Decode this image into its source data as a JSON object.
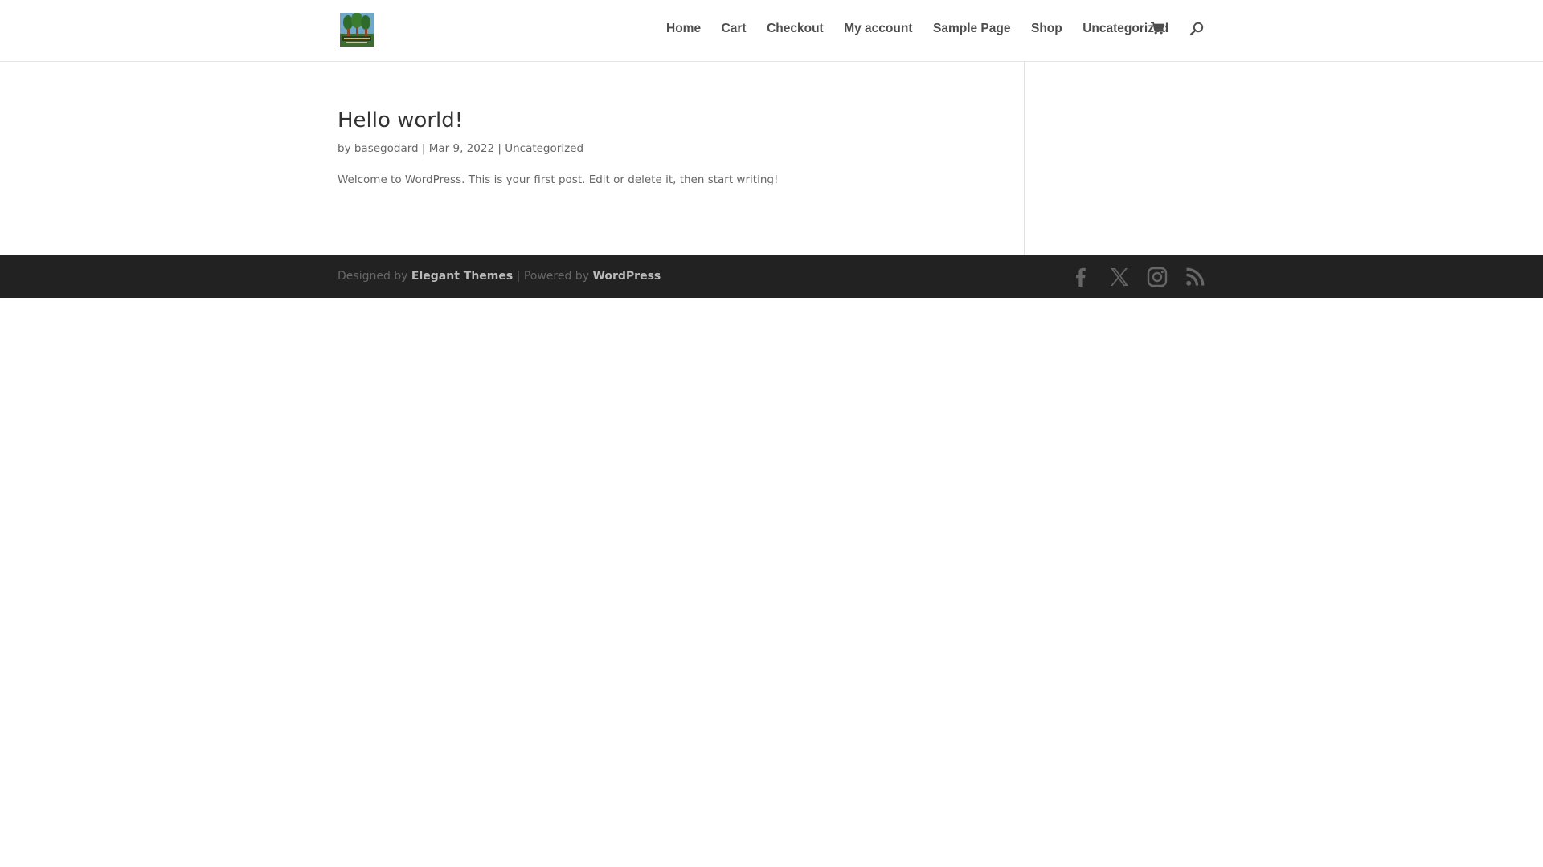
{
  "colors": {
    "header_bg": "#ffffff",
    "nav_text": "#4d4d4d",
    "title_text": "#333333",
    "body_text": "#666666",
    "footer_bg": "#222222",
    "footer_link": "#bbbbbb",
    "social_icon": "#666666"
  },
  "header": {
    "logo_icon": "elevated-trees-logo",
    "nav": [
      {
        "label": "Home"
      },
      {
        "label": "Cart"
      },
      {
        "label": "Checkout"
      },
      {
        "label": "My account"
      },
      {
        "label": "Sample Page"
      },
      {
        "label": "Shop"
      },
      {
        "label": "Uncategorized"
      }
    ],
    "cart_icon": "shopping-cart-icon",
    "search_icon": "search-icon"
  },
  "post": {
    "title": "Hello world!",
    "meta": {
      "by": "by",
      "author": "basegodard",
      "sep1": "|",
      "date": "Mar 9, 2022",
      "sep2": "|",
      "category": "Uncategorized"
    },
    "excerpt": "Welcome to WordPress. This is your first post. Edit or delete it, then start writing!"
  },
  "footer": {
    "designed_by": "Designed by",
    "designer": "Elegant Themes",
    "separator": "| Powered by",
    "platform": "WordPress",
    "social": [
      "facebook-icon",
      "x-twitter-icon",
      "instagram-icon",
      "rss-icon"
    ]
  }
}
